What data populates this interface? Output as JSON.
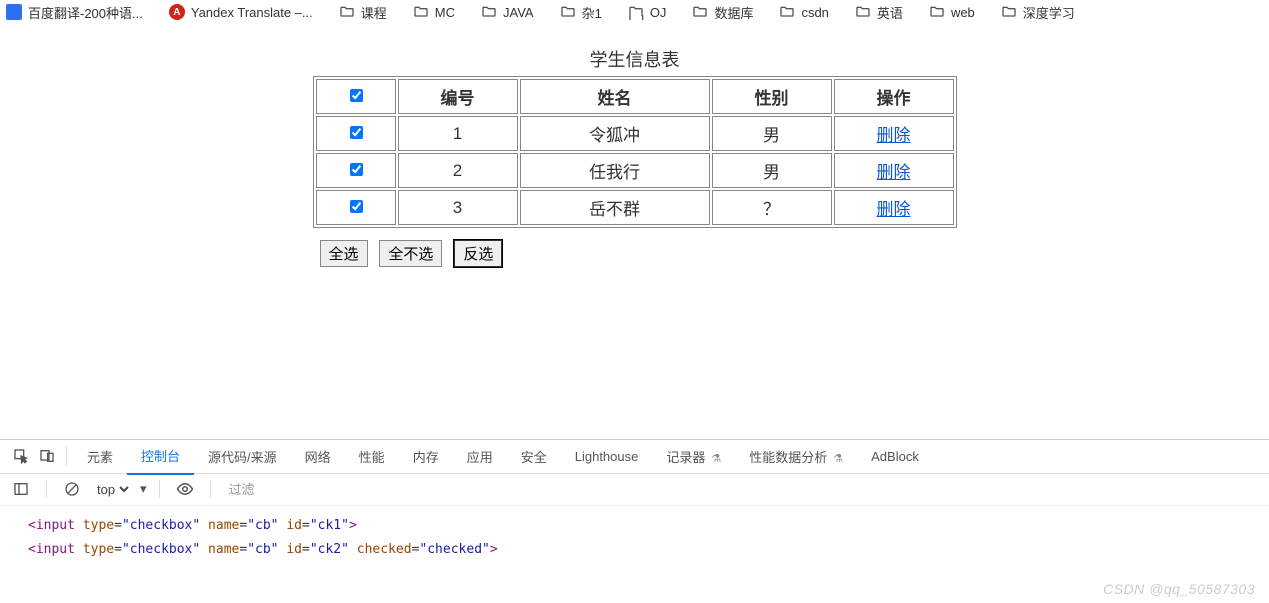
{
  "bookmarks": {
    "baidu": "百度翻译-200种语...",
    "yandex": "Yandex Translate –...",
    "folders": [
      "课程",
      "MC",
      "JAVA",
      "杂1",
      "OJ",
      "数据库",
      "csdn",
      "英语",
      "web",
      "深度学习"
    ]
  },
  "page": {
    "caption": "学生信息表",
    "headers": {
      "id": "编号",
      "name": "姓名",
      "gender": "性别",
      "op": "操作"
    },
    "rows": [
      {
        "id": "1",
        "name": "令狐冲",
        "gender": "男",
        "op": "删除"
      },
      {
        "id": "2",
        "name": "任我行",
        "gender": "男",
        "op": "删除"
      },
      {
        "id": "3",
        "name": "岳不群",
        "gender": "？",
        "op": "删除"
      }
    ],
    "buttons": {
      "all": "全选",
      "none": "全不选",
      "invert": "反选"
    }
  },
  "devtools": {
    "tabs": {
      "elements": "元素",
      "console": "控制台",
      "sources": "源代码/来源",
      "network": "网络",
      "performance": "性能",
      "memory": "内存",
      "application": "应用",
      "security": "安全",
      "lighthouse": "Lighthouse",
      "recorder": "记录器",
      "perf_insights": "性能数据分析",
      "adblock": "AdBlock"
    },
    "toolbar": {
      "context": "top",
      "filter_placeholder": "过滤"
    },
    "console_lines": [
      "<input type=\"checkbox\" name=\"cb\" id=\"ck1\">",
      "<input type=\"checkbox\" name=\"cb\" id=\"ck2\" checked=\"checked\">"
    ]
  },
  "watermark": "CSDN @qq_50587303"
}
